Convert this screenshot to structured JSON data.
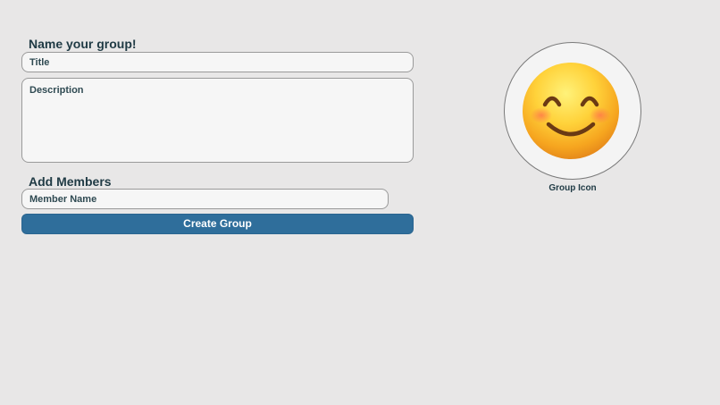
{
  "group_section": {
    "heading": "Name your group!",
    "title_placeholder": "Title",
    "description_placeholder": "Description"
  },
  "members_section": {
    "heading": "Add Members",
    "member_placeholder": "Member Name"
  },
  "create_button_label": "Create Group",
  "group_icon": {
    "emoji": "smiling-face-with-smiling-eyes",
    "label": "Group Icon"
  },
  "colors": {
    "background": "#e8e7e7",
    "primary_button": "#2f6e9b",
    "heading_text": "#1f3a44"
  }
}
